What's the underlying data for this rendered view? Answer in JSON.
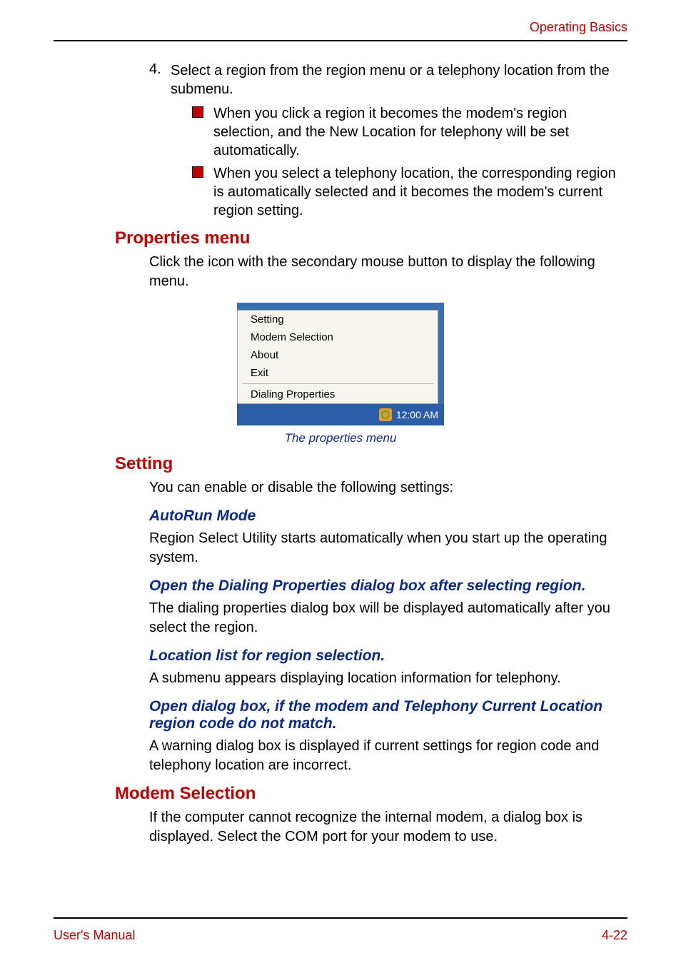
{
  "header": {
    "section": "Operating Basics"
  },
  "footer": {
    "left": "User's Manual",
    "right": "4-22"
  },
  "step4": {
    "num": "4.",
    "text": "Select a region from the region menu or a telephony location from the submenu.",
    "bullets": [
      "When you click a region it becomes the modem's region selection, and the New Location for telephony will be set automatically.",
      "When you select a telephony location, the corresponding region is automatically selected and it becomes the modem's current region setting."
    ]
  },
  "properties_menu": {
    "heading": "Properties menu",
    "body": "Click the icon with the secondary mouse button to display the following menu.",
    "menu_items": [
      "Setting",
      "Modem Selection",
      "About",
      "Exit"
    ],
    "menu_item_sep": "Dialing Properties",
    "clock": "12:00 AM",
    "caption": "The properties menu"
  },
  "setting": {
    "heading": "Setting",
    "intro": "You can enable or disable the following settings:",
    "autorun": {
      "title": "AutoRun Mode",
      "body": "Region Select Utility starts automatically when you start up the operating system."
    },
    "open_dialing": {
      "title": "Open the Dialing Properties dialog box after selecting region.",
      "body": "The dialing properties dialog box will be displayed automatically after you select the region."
    },
    "location_list": {
      "title": "Location list for region selection.",
      "body": "A submenu appears displaying location information for telephony."
    },
    "mismatch": {
      "title": "Open dialog box, if the modem and Telephony Current Location region code do not match.",
      "body": "A warning dialog box is displayed if current settings for region code and telephony location are incorrect."
    }
  },
  "modem_selection": {
    "heading": "Modem Selection",
    "body": "If the computer cannot recognize the internal modem, a dialog box is displayed. Select the COM port for your modem to use."
  }
}
